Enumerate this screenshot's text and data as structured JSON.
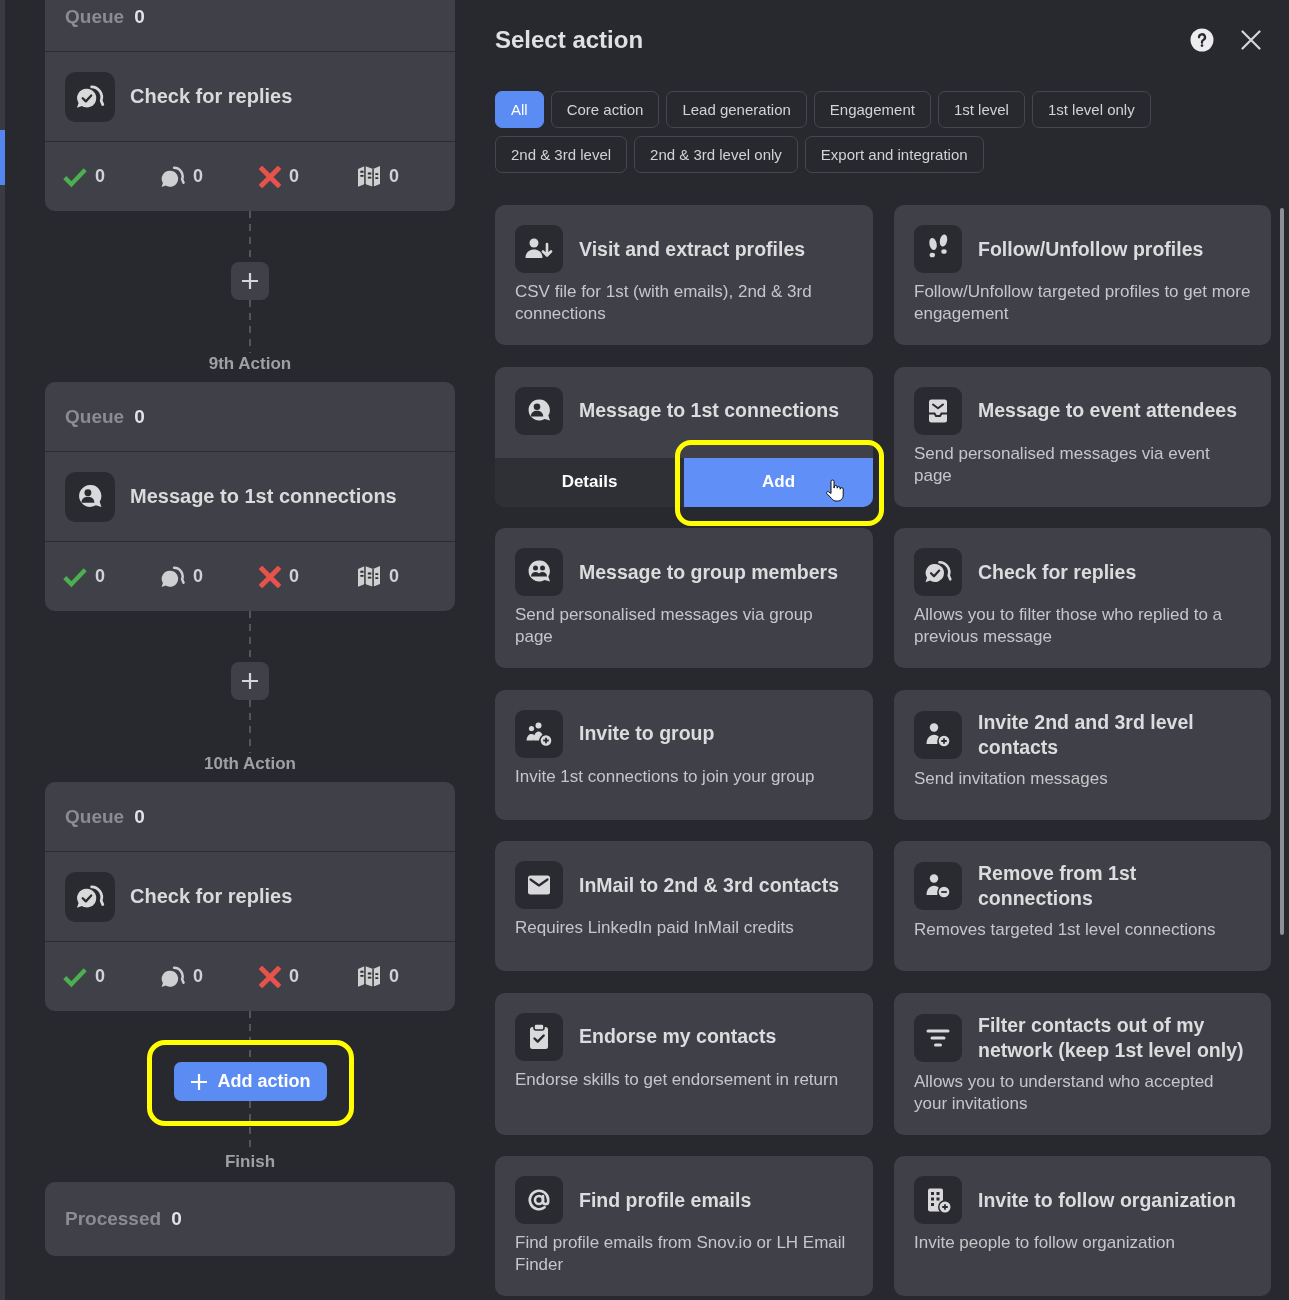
{
  "flow": {
    "items": [
      {
        "kind": "step",
        "queue_label": "Queue",
        "queue_count": "0",
        "title": "Check for replies",
        "stats": [
          {
            "kind": "check",
            "count": "0"
          },
          {
            "kind": "chat",
            "count": "0"
          },
          {
            "kind": "cross",
            "count": "0"
          },
          {
            "kind": "map",
            "count": "0"
          }
        ]
      },
      {
        "kind": "connector",
        "label": "9th Action"
      },
      {
        "kind": "step",
        "queue_label": "Queue",
        "queue_count": "0",
        "title": "Message to 1st connections",
        "stats": [
          {
            "kind": "check",
            "count": "0"
          },
          {
            "kind": "chat",
            "count": "0"
          },
          {
            "kind": "cross",
            "count": "0"
          },
          {
            "kind": "map",
            "count": "0"
          }
        ]
      },
      {
        "kind": "connector",
        "label": "10th Action"
      },
      {
        "kind": "step",
        "queue_label": "Queue",
        "queue_count": "0",
        "title": "Check for replies",
        "stats": [
          {
            "kind": "check",
            "count": "0"
          },
          {
            "kind": "chat",
            "count": "0"
          },
          {
            "kind": "cross",
            "count": "0"
          },
          {
            "kind": "map",
            "count": "0"
          }
        ]
      },
      {
        "kind": "add_connector",
        "button": "Add action",
        "highlighted": true,
        "label": "Finish"
      },
      {
        "kind": "summary",
        "label": "Processed",
        "count": "0"
      }
    ]
  },
  "panel": {
    "title": "Select action",
    "filters": [
      {
        "label": "All",
        "selected": true
      },
      {
        "label": "Core action",
        "selected": false
      },
      {
        "label": "Lead generation",
        "selected": false
      },
      {
        "label": "Engagement",
        "selected": false
      },
      {
        "label": "1st level",
        "selected": false
      },
      {
        "label": "1st level only",
        "selected": false
      },
      {
        "label": "2nd & 3rd level",
        "selected": false
      },
      {
        "label": "2nd & 3rd level only",
        "selected": false
      },
      {
        "label": "Export and integration",
        "selected": false
      }
    ],
    "actions": [
      {
        "title": "Visit and extract profiles",
        "description": "CSV file for 1st (with emails), 2nd & 3rd connections",
        "hovered": false
      },
      {
        "title": "Follow/Unfollow profiles",
        "description": "Follow/Unfollow targeted profiles to get more engagement",
        "hovered": false
      },
      {
        "title": "Message to 1st connections",
        "hovered": true,
        "details_label": "Details",
        "add_label": "Add",
        "highlighted": true
      },
      {
        "title": "Message to event attendees",
        "description": "Send personalised messages via event page",
        "hovered": false
      },
      {
        "title": "Message to group members",
        "description": "Send personalised messages via group page",
        "hovered": false
      },
      {
        "title": "Check for replies",
        "description": "Allows you to filter those who replied to a previous message",
        "hovered": false
      },
      {
        "title": "Invite to group",
        "description": "Invite 1st connections to join your group",
        "hovered": false
      },
      {
        "title": "Invite 2nd and 3rd level contacts",
        "description": "Send invitation messages",
        "hovered": false
      },
      {
        "title": "InMail to 2nd & 3rd contacts",
        "description": "Requires LinkedIn paid InMail credits",
        "hovered": false
      },
      {
        "title": "Remove from 1st connections",
        "description": "Removes targeted 1st level connections",
        "hovered": false
      },
      {
        "title": "Endorse my contacts",
        "description": "Endorse skills to get endorsement in return",
        "hovered": false
      },
      {
        "title": "Filter contacts out of my network (keep 1st level only)",
        "description": "Allows you to understand who accepted your invitations",
        "hovered": false
      },
      {
        "title": "Find profile emails",
        "description": "Find profile emails from Snov.io or LH Email Finder",
        "hovered": false
      },
      {
        "title": "Invite to follow organization",
        "description": "Invite people to follow organization",
        "hovered": false
      }
    ]
  }
}
